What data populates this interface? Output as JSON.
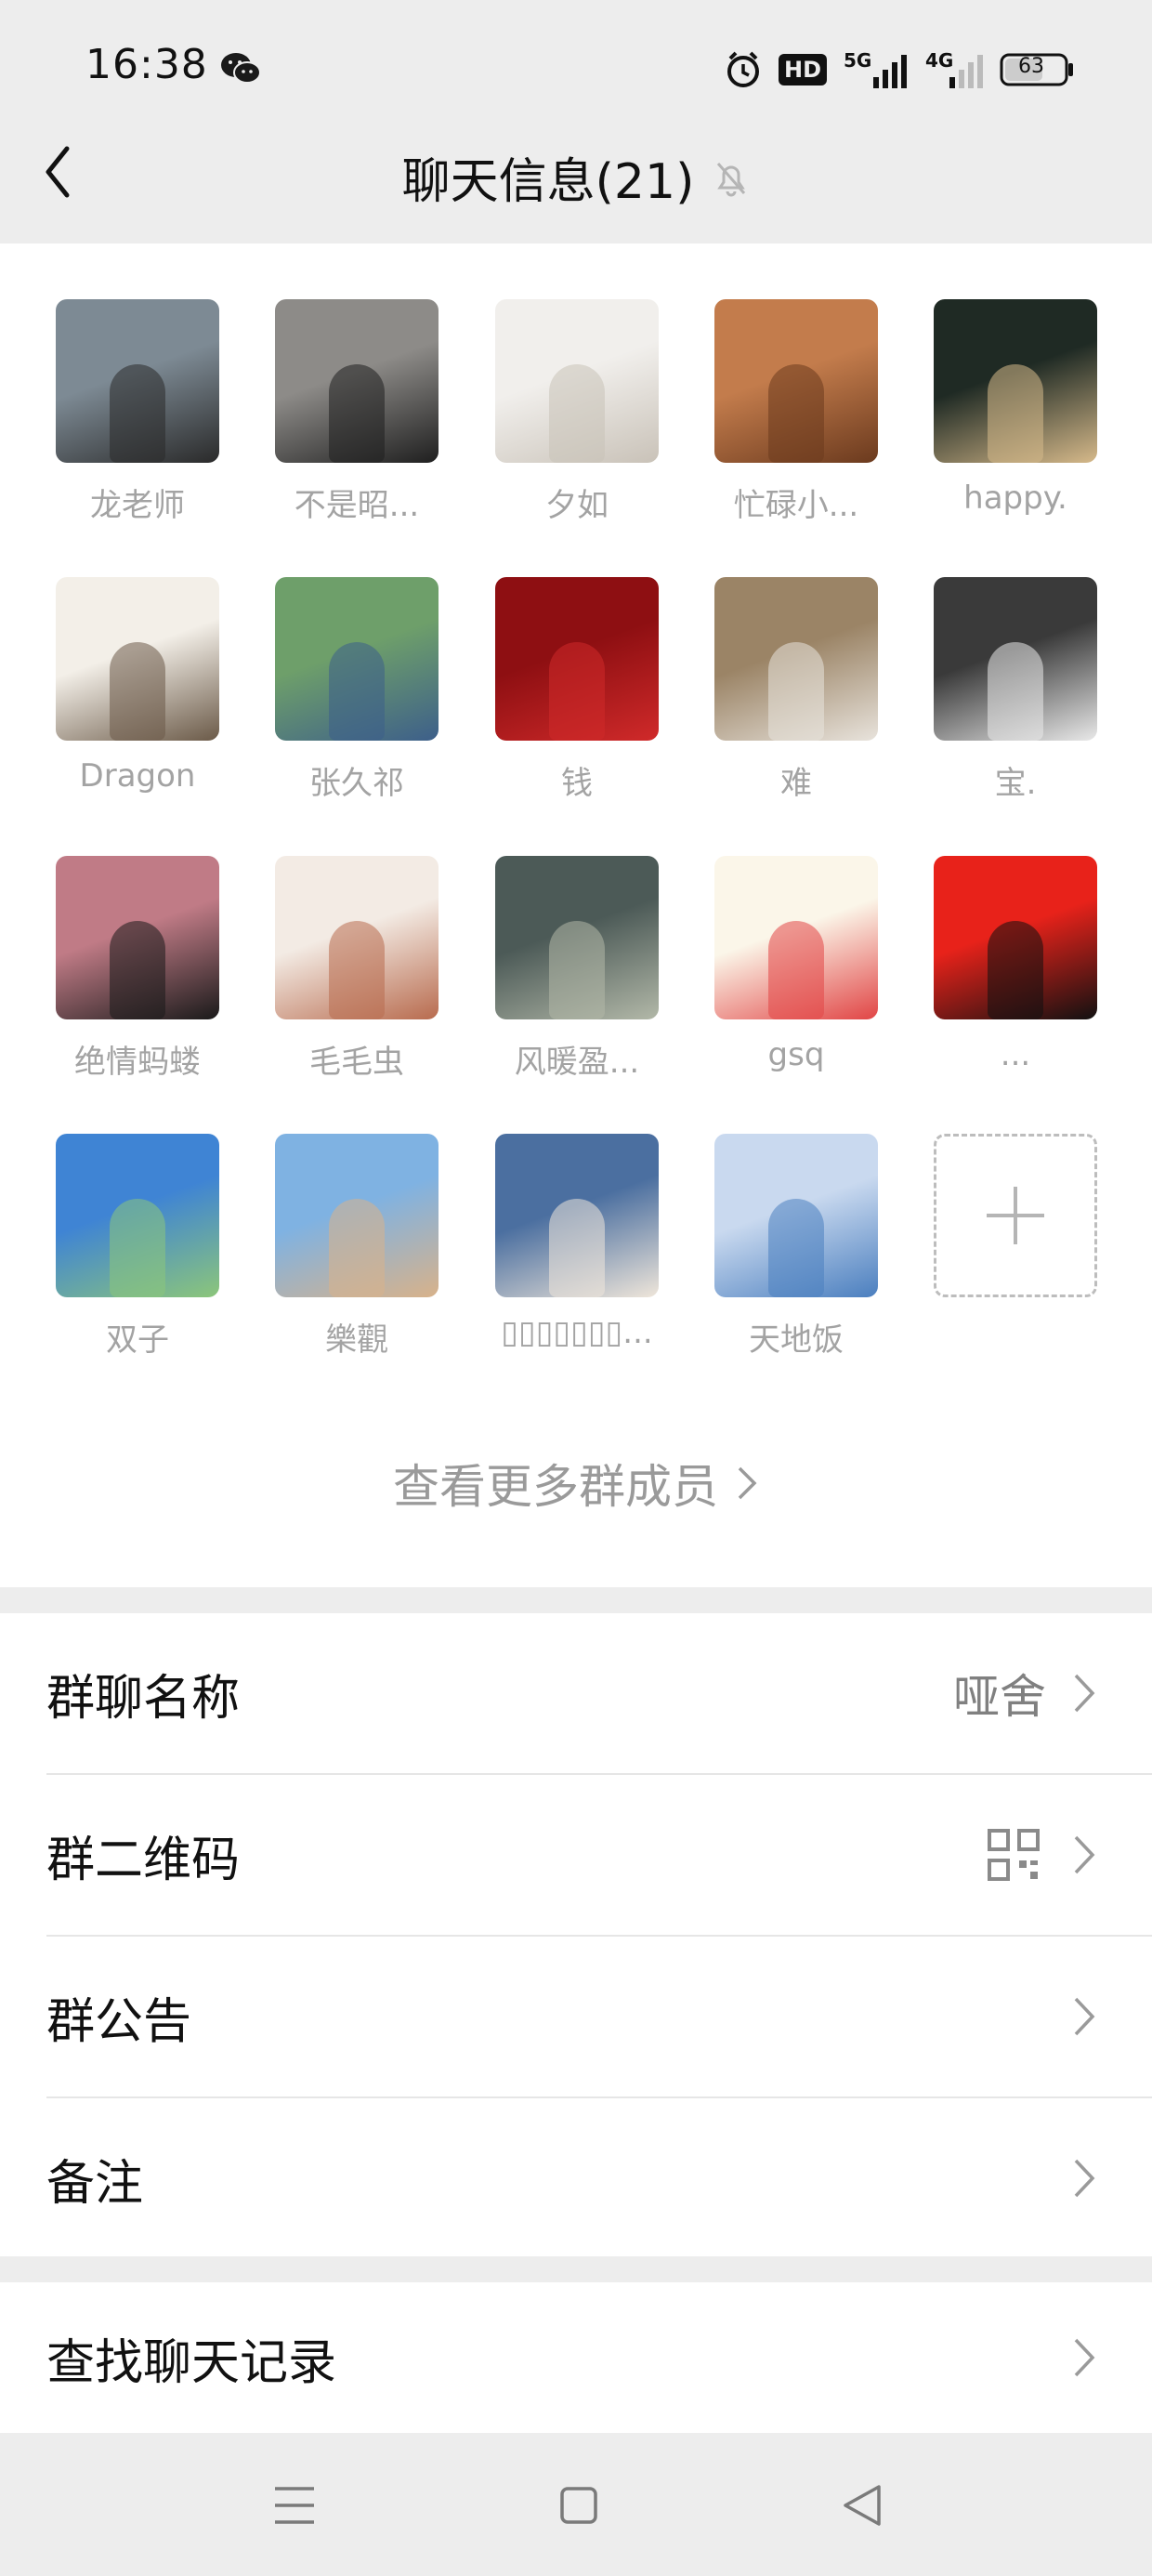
{
  "status_bar": {
    "time": "16:38",
    "hd_label": "HD",
    "signal_5g": "5G",
    "signal_4g": "4G",
    "battery": "63"
  },
  "header": {
    "title": "聊天信息(21)"
  },
  "members": [
    {
      "name": "龙老师",
      "avatar_colors": [
        "#7d8a94",
        "#2a2a2a"
      ]
    },
    {
      "name": "不是昭...",
      "avatar_colors": [
        "#8d8b88",
        "#1f1f1f"
      ]
    },
    {
      "name": "夕如",
      "avatar_colors": [
        "#f1efec",
        "#c9c2b8"
      ]
    },
    {
      "name": "忙碌小...",
      "avatar_colors": [
        "#c37c4c",
        "#6b3a1e"
      ]
    },
    {
      "name": "happy.",
      "avatar_colors": [
        "#1f2a24",
        "#d6b98a"
      ]
    },
    {
      "name": "Dragon",
      "avatar_colors": [
        "#f3efe8",
        "#6b5a48"
      ]
    },
    {
      "name": "张久祁",
      "avatar_colors": [
        "#6e9f6a",
        "#3d5f8a"
      ]
    },
    {
      "name": "钱",
      "avatar_colors": [
        "#8e0f12",
        "#d02a2a"
      ]
    },
    {
      "name": "难",
      "avatar_colors": [
        "#9b8466",
        "#e8e3dc"
      ]
    },
    {
      "name": "宝.",
      "avatar_colors": [
        "#3a3a3a",
        "#e9e9e9"
      ]
    },
    {
      "name": "绝情蚂蝼",
      "avatar_colors": [
        "#c07b86",
        "#1a1a1a"
      ]
    },
    {
      "name": "毛毛虫",
      "avatar_colors": [
        "#f3ebe4",
        "#b86b4e"
      ]
    },
    {
      "name": "风暖盈...",
      "avatar_colors": [
        "#4c5a57",
        "#b2b8a8"
      ]
    },
    {
      "name": "gsq",
      "avatar_colors": [
        "#fbf6e9",
        "#e14545"
      ]
    },
    {
      "name": "...",
      "avatar_colors": [
        "#e8221a",
        "#111111"
      ]
    },
    {
      "name": "双子",
      "avatar_colors": [
        "#3f84d4",
        "#8cc67a"
      ]
    },
    {
      "name": "樂觀",
      "avatar_colors": [
        "#7fb2e2",
        "#d8b28a"
      ]
    },
    {
      "name": "▯▯▯▯▯▯▯...",
      "avatar_colors": [
        "#4b6fa0",
        "#efe6da"
      ]
    },
    {
      "name": "天地饭",
      "avatar_colors": [
        "#c9d9ef",
        "#4b7fbf"
      ]
    }
  ],
  "more_members_label": "查看更多群成员",
  "settings": {
    "group_name": {
      "label": "群聊名称",
      "value": "哑舍"
    },
    "qr_code": {
      "label": "群二维码"
    },
    "announcement": {
      "label": "群公告"
    },
    "remark": {
      "label": "备注"
    },
    "search_history": {
      "label": "查找聊天记录"
    }
  },
  "colors": {
    "background": "#ededed",
    "panel": "#ffffff",
    "secondary_text": "#a3a3a3"
  }
}
